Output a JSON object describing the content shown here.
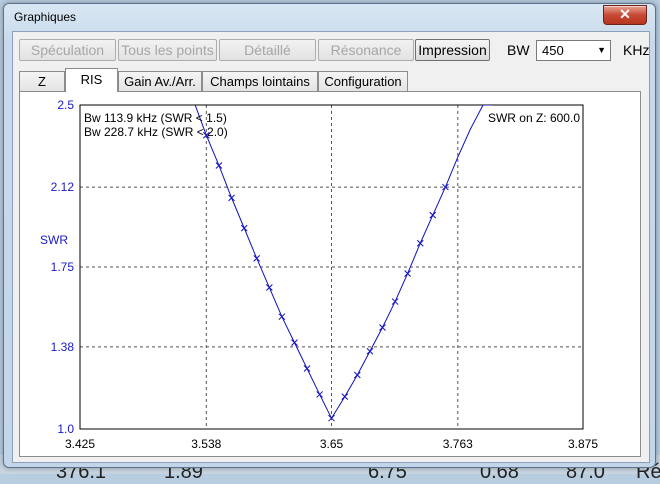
{
  "window": {
    "title": "Graphiques",
    "close_glyph": "✕"
  },
  "toolbar": {
    "buttons": [
      {
        "label": "Spéculation",
        "enabled": false
      },
      {
        "label": "Tous les points",
        "enabled": false
      },
      {
        "label": "Détaillé",
        "enabled": false
      },
      {
        "label": "Résonance",
        "enabled": false
      },
      {
        "label": "Impression",
        "enabled": true
      }
    ],
    "bw_label": "BW",
    "bw_value": "450",
    "bw_unit": "KHz"
  },
  "tabs": [
    {
      "label": "Z",
      "active": false
    },
    {
      "label": "RIS",
      "active": true
    },
    {
      "label": "Gain Av./Arr.",
      "active": false
    },
    {
      "label": "Champs lointains",
      "active": false
    },
    {
      "label": "Configuration",
      "active": false
    }
  ],
  "background": {
    "texts": [
      "376.1",
      "1.89",
      "6.75",
      "0.68",
      "87.0",
      "Ré"
    ]
  },
  "colors": {
    "curve": "#1010c0",
    "axis_text": "#1a1acc",
    "grid": "#555555"
  },
  "chart_data": {
    "type": "line",
    "ylabel": "SWR",
    "x_ticks": [
      "3.425",
      "3.538",
      "3.65",
      "3.763",
      "3.875"
    ],
    "y_ticks": [
      "1.0",
      "1.38",
      "1.75",
      "2.12",
      "2.5"
    ],
    "xlim": [
      3.425,
      3.875
    ],
    "ylim": [
      1.0,
      2.5
    ],
    "annotations": [
      "Bw 113.9 kHz (SWR < 1.5)",
      "Bw 228.7 kHz (SWR < 2.0)"
    ],
    "annotation_right": "SWR on Z: 600.0",
    "series": [
      {
        "x": [
          3.528,
          3.538,
          3.5493,
          3.5606,
          3.5719,
          3.5831,
          3.5944,
          3.6056,
          3.6169,
          3.6281,
          3.6394,
          3.65,
          3.6619,
          3.6731,
          3.6844,
          3.6956,
          3.7069,
          3.7181,
          3.7294,
          3.7406,
          3.7519,
          3.7631,
          3.7744,
          3.7856,
          3.793
        ],
        "y": [
          2.5,
          2.36,
          2.22,
          2.07,
          1.93,
          1.79,
          1.655,
          1.52,
          1.4,
          1.28,
          1.16,
          1.05,
          1.15,
          1.25,
          1.36,
          1.47,
          1.59,
          1.72,
          1.86,
          1.99,
          2.12,
          2.26,
          2.39,
          2.5,
          2.5
        ],
        "markers_x": [
          3.538,
          3.5493,
          3.5606,
          3.5719,
          3.5831,
          3.5944,
          3.6056,
          3.6169,
          3.6281,
          3.6394,
          3.65,
          3.6619,
          3.6731,
          3.6844,
          3.6956,
          3.7069,
          3.7181,
          3.7294,
          3.7406,
          3.7519
        ],
        "markers_y": [
          2.36,
          2.22,
          2.07,
          1.93,
          1.79,
          1.655,
          1.52,
          1.4,
          1.28,
          1.16,
          1.05,
          1.15,
          1.25,
          1.36,
          1.47,
          1.59,
          1.72,
          1.86,
          1.99,
          2.12
        ]
      }
    ],
    "grid": true
  }
}
